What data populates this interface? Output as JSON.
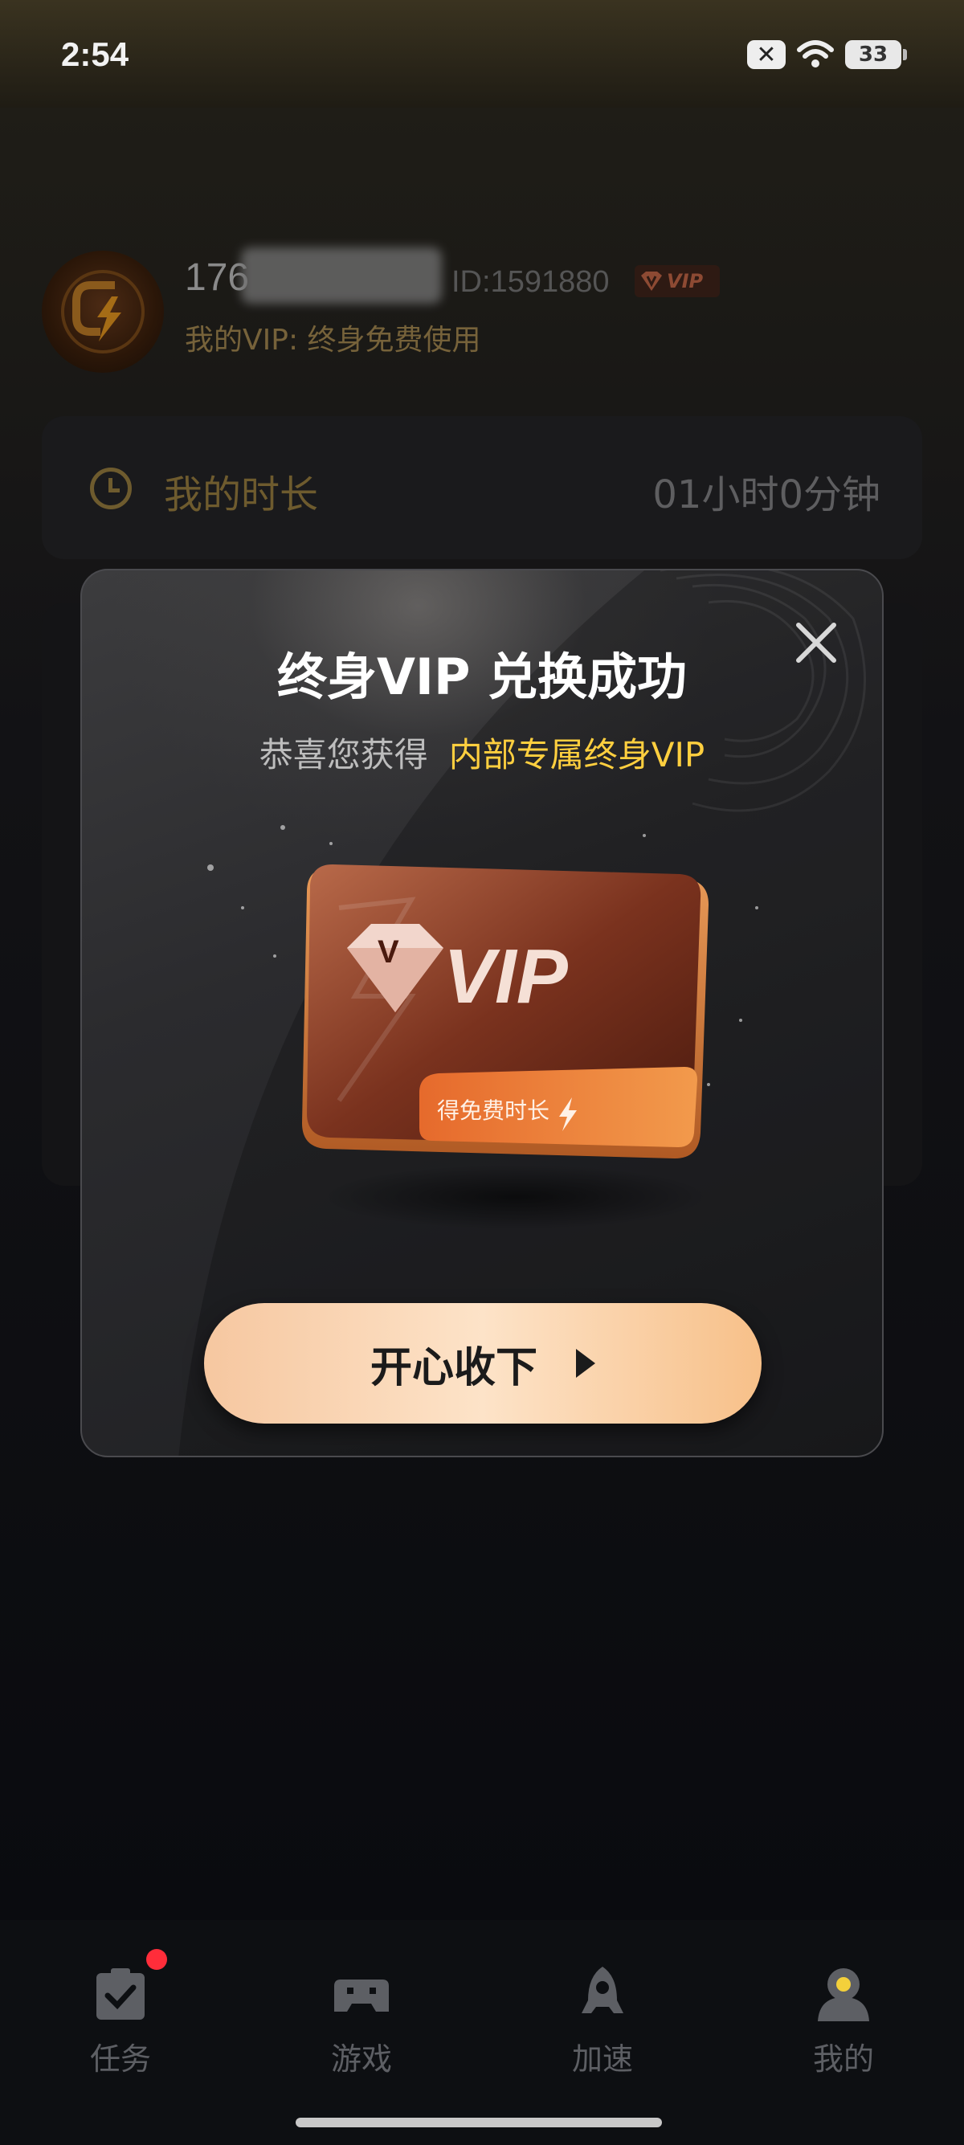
{
  "status_bar": {
    "time": "2:54",
    "battery": "33"
  },
  "profile": {
    "phone_prefix": "176",
    "user_id": "ID:1591880",
    "vip_badge": "VIP",
    "vip_status": "我的VIP: 终身免费使用"
  },
  "duration": {
    "label": "我的时长",
    "value": "01小时0分钟"
  },
  "modal": {
    "title": "终身VIP 兑换成功",
    "subtitle": "恭喜您获得",
    "highlight": "内部专属终身VIP",
    "card_logo_text": "VIP",
    "card_tag": "得免费时长",
    "accept_label": "开心收下"
  },
  "tabs": [
    {
      "label": "任务",
      "icon": "task-check-icon",
      "has_badge": true
    },
    {
      "label": "游戏",
      "icon": "gamepad-icon",
      "has_badge": false
    },
    {
      "label": "加速",
      "icon": "rocket-icon",
      "has_badge": false
    },
    {
      "label": "我的",
      "icon": "profile-icon",
      "has_badge": false
    }
  ],
  "colors": {
    "accent_gold": "#ffcf3f",
    "button_gradient_start": "#f6c7a0",
    "button_gradient_end": "#f7c089",
    "badge_red": "#ff2d3a"
  }
}
